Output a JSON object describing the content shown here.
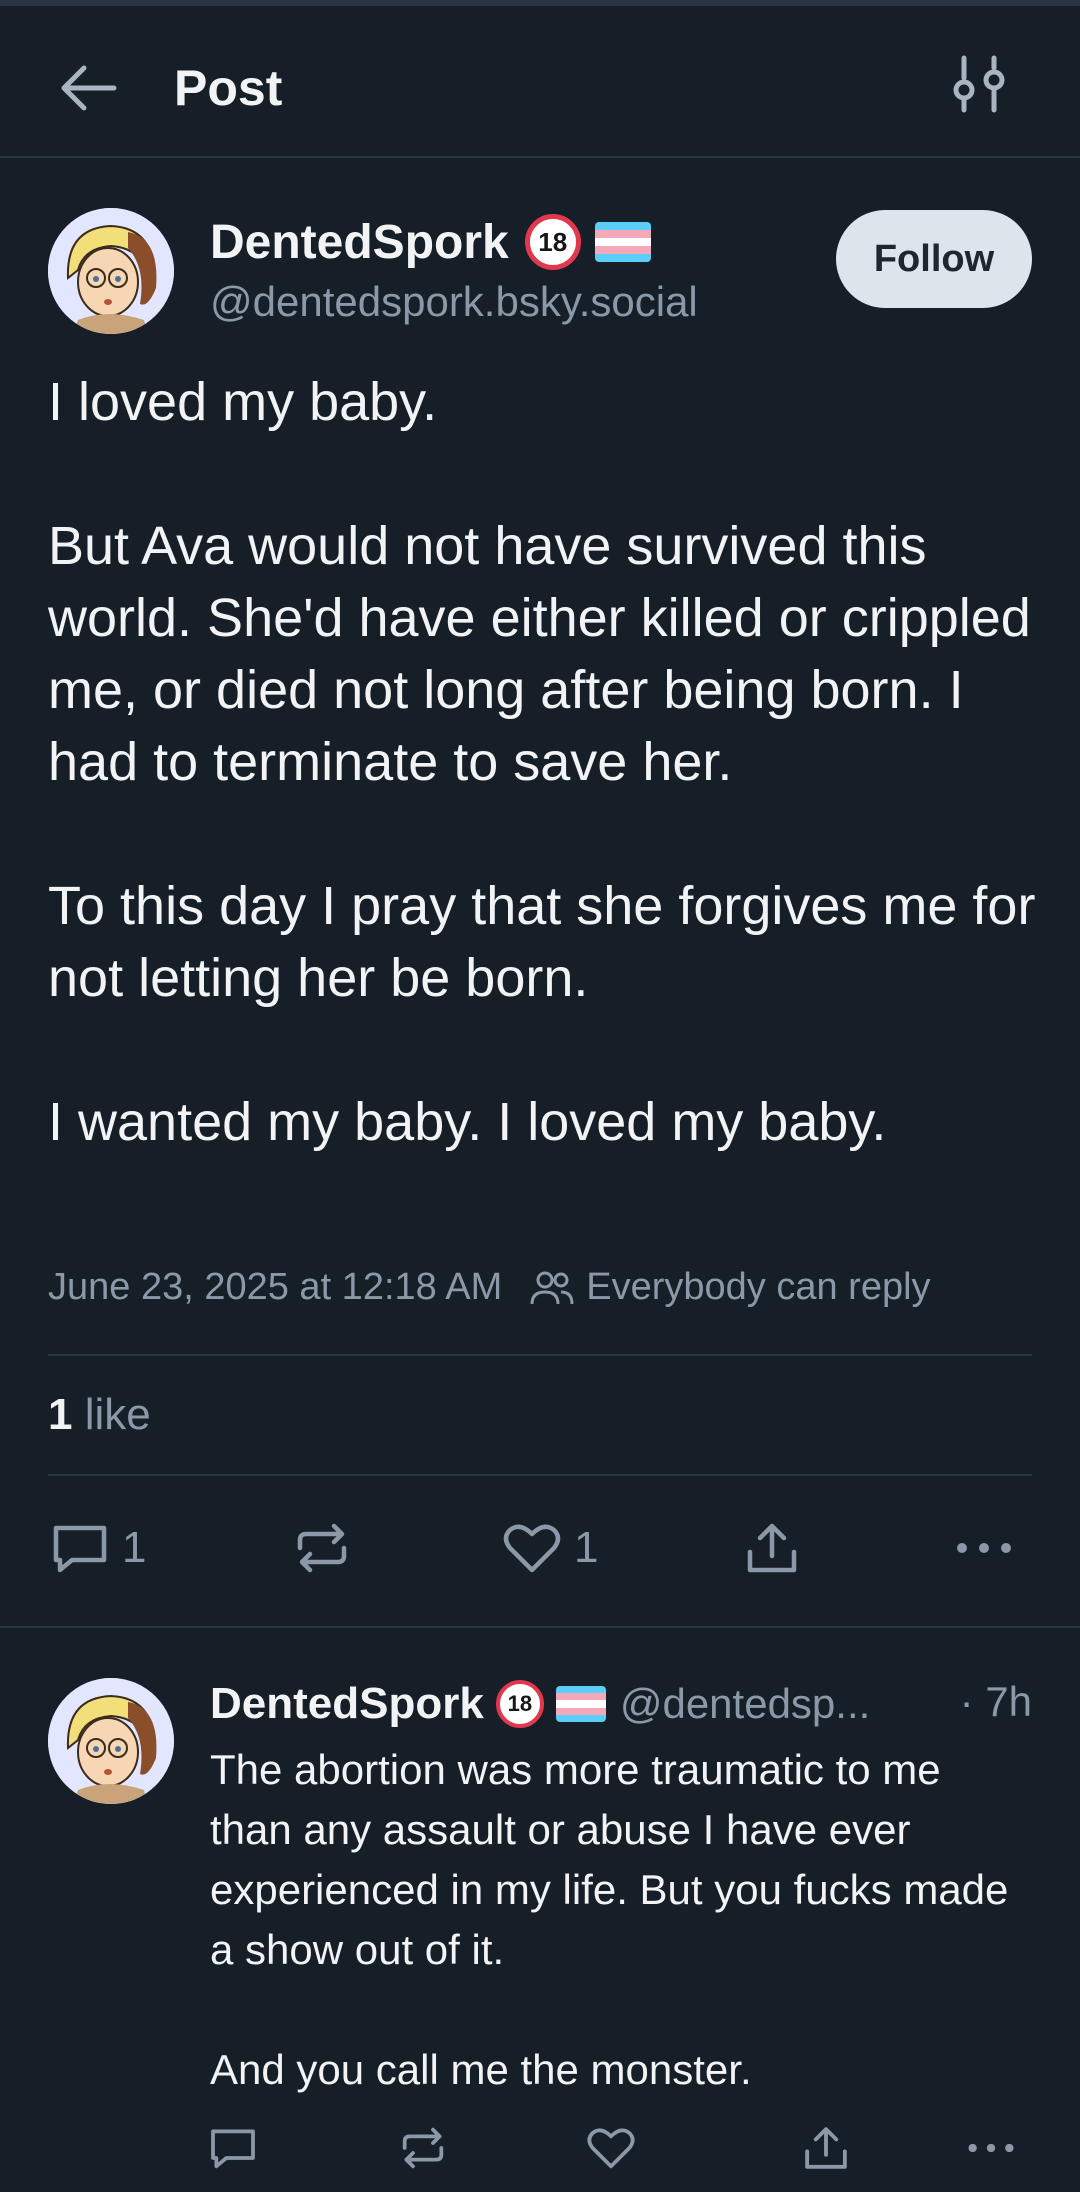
{
  "header": {
    "title": "Post"
  },
  "post": {
    "author_name": "DentedSpork",
    "author_handle": "@dentedspork.bsky.social",
    "follow_label": "Follow",
    "paragraphs": [
      "I loved my baby.",
      "But Ava would not have survived this world. She'd have either killed or crippled me, or died not long after being born. I had to terminate to save her.",
      "To this day I pray that she forgives me for not letting her be born.",
      "I wanted my baby. I loved my baby."
    ],
    "timestamp": "June 23, 2025 at 12:18 AM",
    "reply_setting": "Everybody can reply",
    "like_count": "1",
    "like_word": "like",
    "actions": {
      "replies": "1",
      "likes": "1"
    }
  },
  "reply": {
    "author_name": "DentedSpork",
    "author_handle": "@dentedsp...",
    "time": "· 7h",
    "paragraphs": [
      "The abortion was more traumatic to me than any assault or abuse I have ever experienced in my life. But you fucks made a show out of it.",
      "And you call me the monster."
    ]
  },
  "badges": {
    "age": "18"
  },
  "colors": {
    "background": "#161e27",
    "muted": "#8b98a7",
    "follow_bg": "#dde4ec",
    "badge_red": "#e2384d",
    "flag": [
      "#5bcefa",
      "#f5a9b8",
      "#ffffff",
      "#f5a9b8",
      "#5bcefa"
    ]
  },
  "icons": [
    "back-arrow-icon",
    "tune-icon",
    "people-icon",
    "reply-icon",
    "repost-icon",
    "heart-icon",
    "share-icon",
    "more-icon"
  ]
}
